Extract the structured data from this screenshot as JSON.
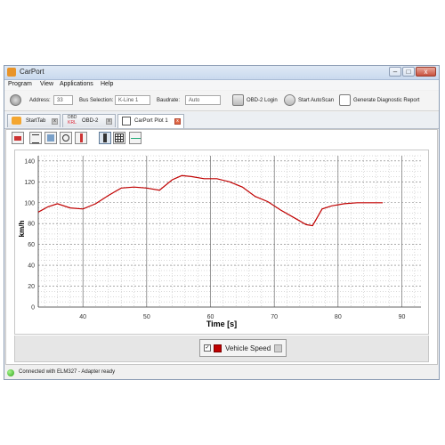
{
  "window": {
    "title": "CarPort",
    "buttons": {
      "minimize": "–",
      "maximize": "□",
      "close": "x"
    }
  },
  "menu": [
    "Program",
    "View",
    "Applications",
    "Help"
  ],
  "toolbar": {
    "address_label": "Address:",
    "address_value": "33",
    "bus_label": "Bus Selection:",
    "bus_value": "K-Line 1",
    "baud_label": "Baudrate:",
    "baud_value": "Auto",
    "obd_login_label": "OBD-2 Login",
    "autoscan_label": "Start AutoScan",
    "report_label": "Generate Diagnostic Report"
  },
  "tabs": [
    {
      "label": "StartTab"
    },
    {
      "label": "OBD-2",
      "icon_text_top": "OBD",
      "icon_text_bottom": "KRL"
    },
    {
      "label": "CarPort Plot 1",
      "active": true
    }
  ],
  "plot_toolbar_icons": [
    "export-icon",
    "list-icon",
    "image-icon",
    "clock-icon",
    "thermometer-icon",
    "person-icon",
    "grid-icon",
    "line-icon"
  ],
  "chart_data": {
    "type": "line",
    "xlabel": "Time [s]",
    "ylabel": "km/h",
    "xlim": [
      33,
      93
    ],
    "ylim": [
      0,
      145
    ],
    "xticks": [
      40,
      50,
      60,
      70,
      80,
      90
    ],
    "yticks": [
      0,
      20,
      40,
      60,
      80,
      100,
      120,
      140
    ],
    "grid": true,
    "series": [
      {
        "name": "Vehicle Speed",
        "color": "#c00000",
        "x": [
          33,
          34.5,
          36,
          38,
          40,
          42,
          44,
          46,
          48,
          50,
          52,
          54,
          55.5,
          57,
          59,
          61,
          63,
          65,
          67,
          69,
          71,
          73,
          75,
          76,
          77.5,
          79,
          81,
          83,
          85,
          87
        ],
        "values": [
          91,
          96,
          99,
          95,
          94,
          99,
          107,
          114,
          115,
          114,
          112,
          122,
          126,
          125,
          123,
          123,
          120,
          115,
          106,
          101,
          93,
          86,
          79,
          78,
          94,
          97,
          99,
          100,
          100,
          100
        ]
      }
    ],
    "legend": {
      "entries": [
        "Vehicle Speed"
      ],
      "position": "bottom-center"
    }
  },
  "status": {
    "text": "Connected with ELM327 - Adapter ready",
    "color": "#2fa418"
  }
}
